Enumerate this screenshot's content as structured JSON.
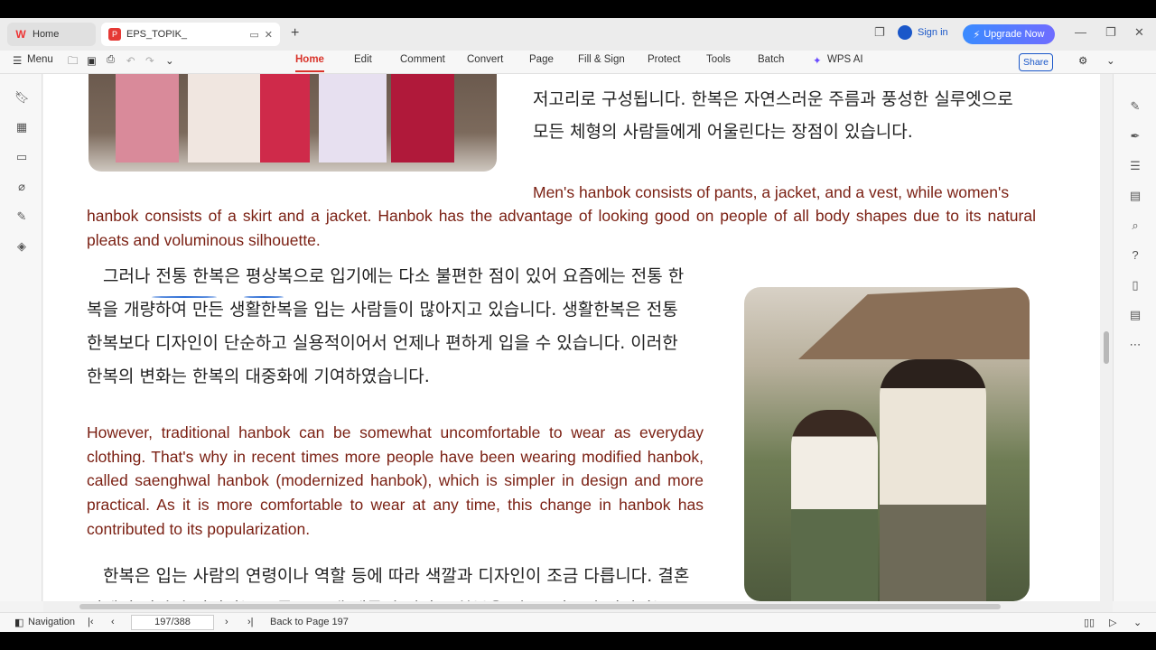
{
  "tabs": [
    {
      "label": "Home"
    },
    {
      "label": "EPS_TOPIK_"
    }
  ],
  "header": {
    "signin": "Sign in",
    "upgrade": "Upgrade Now"
  },
  "menu": {
    "menu_label": "Menu",
    "items": [
      "Home",
      "Edit",
      "Comment",
      "Convert",
      "Page",
      "Fill & Sign",
      "Protect",
      "Tools",
      "Batch",
      "WPS AI"
    ],
    "share": "Share"
  },
  "document": {
    "ko_top_lines": [
      "저고리로 구성됩니다. 한복은 자연스러운 주름과 풍성한 실루엣으로",
      "모든 체형의 사람들에게 어울린다는 장점이 있습니다."
    ],
    "en_top_first": "Men's hanbok consists of pants, a jacket, and a vest, while women's",
    "en_top_rest": "hanbok consists of a skirt and a jacket. Hanbok has the advantage of looking good on people of all body shapes due to its natural pleats and voluminous silhouette.",
    "ko_mid": [
      "그러나 전통 한복은 평상복으로 입기에는 다소 불편한 점이 있어 요즘에는 전통 한",
      "복을 개량하여 만든 생활한복을 입는 사람들이 많아지고 있습니다. 생활한복은 전통",
      "한복보다 디자인이 단순하고 실용적이어서 언제나 편하게 입을 수 있습니다. 이러한",
      "한복의 변화는 한복의 대중화에 기여하였습니다."
    ],
    "en_mid": "However, traditional hanbok can be somewhat uncomfortable to wear as everyday clothing. That's why in recent times more people have been wearing modified hanbok, called saenghwal hanbok (modernized hanbok), which is simpler in design and more practical. As it is more comfortable to wear at any time, this change in hanbok has contributed to its popularization.",
    "ko_bottom": [
      "한복은 입는 사람의 연령이나 역할 등에 따라 색깔과 디자인이 조금 다릅니다. 결혼",
      "식에서 신랑의 어머니는 보통 푸른색 계통의 점잖은 한복을 입고, 신부의 어머니는 분"
    ]
  },
  "status": {
    "navigation": "Navigation",
    "page_value": "197/388",
    "back_to": "Back to Page 197"
  },
  "colors": {
    "accent": "#d9342b",
    "english_text": "#7a1f12",
    "link_blue": "#1a57c9"
  }
}
